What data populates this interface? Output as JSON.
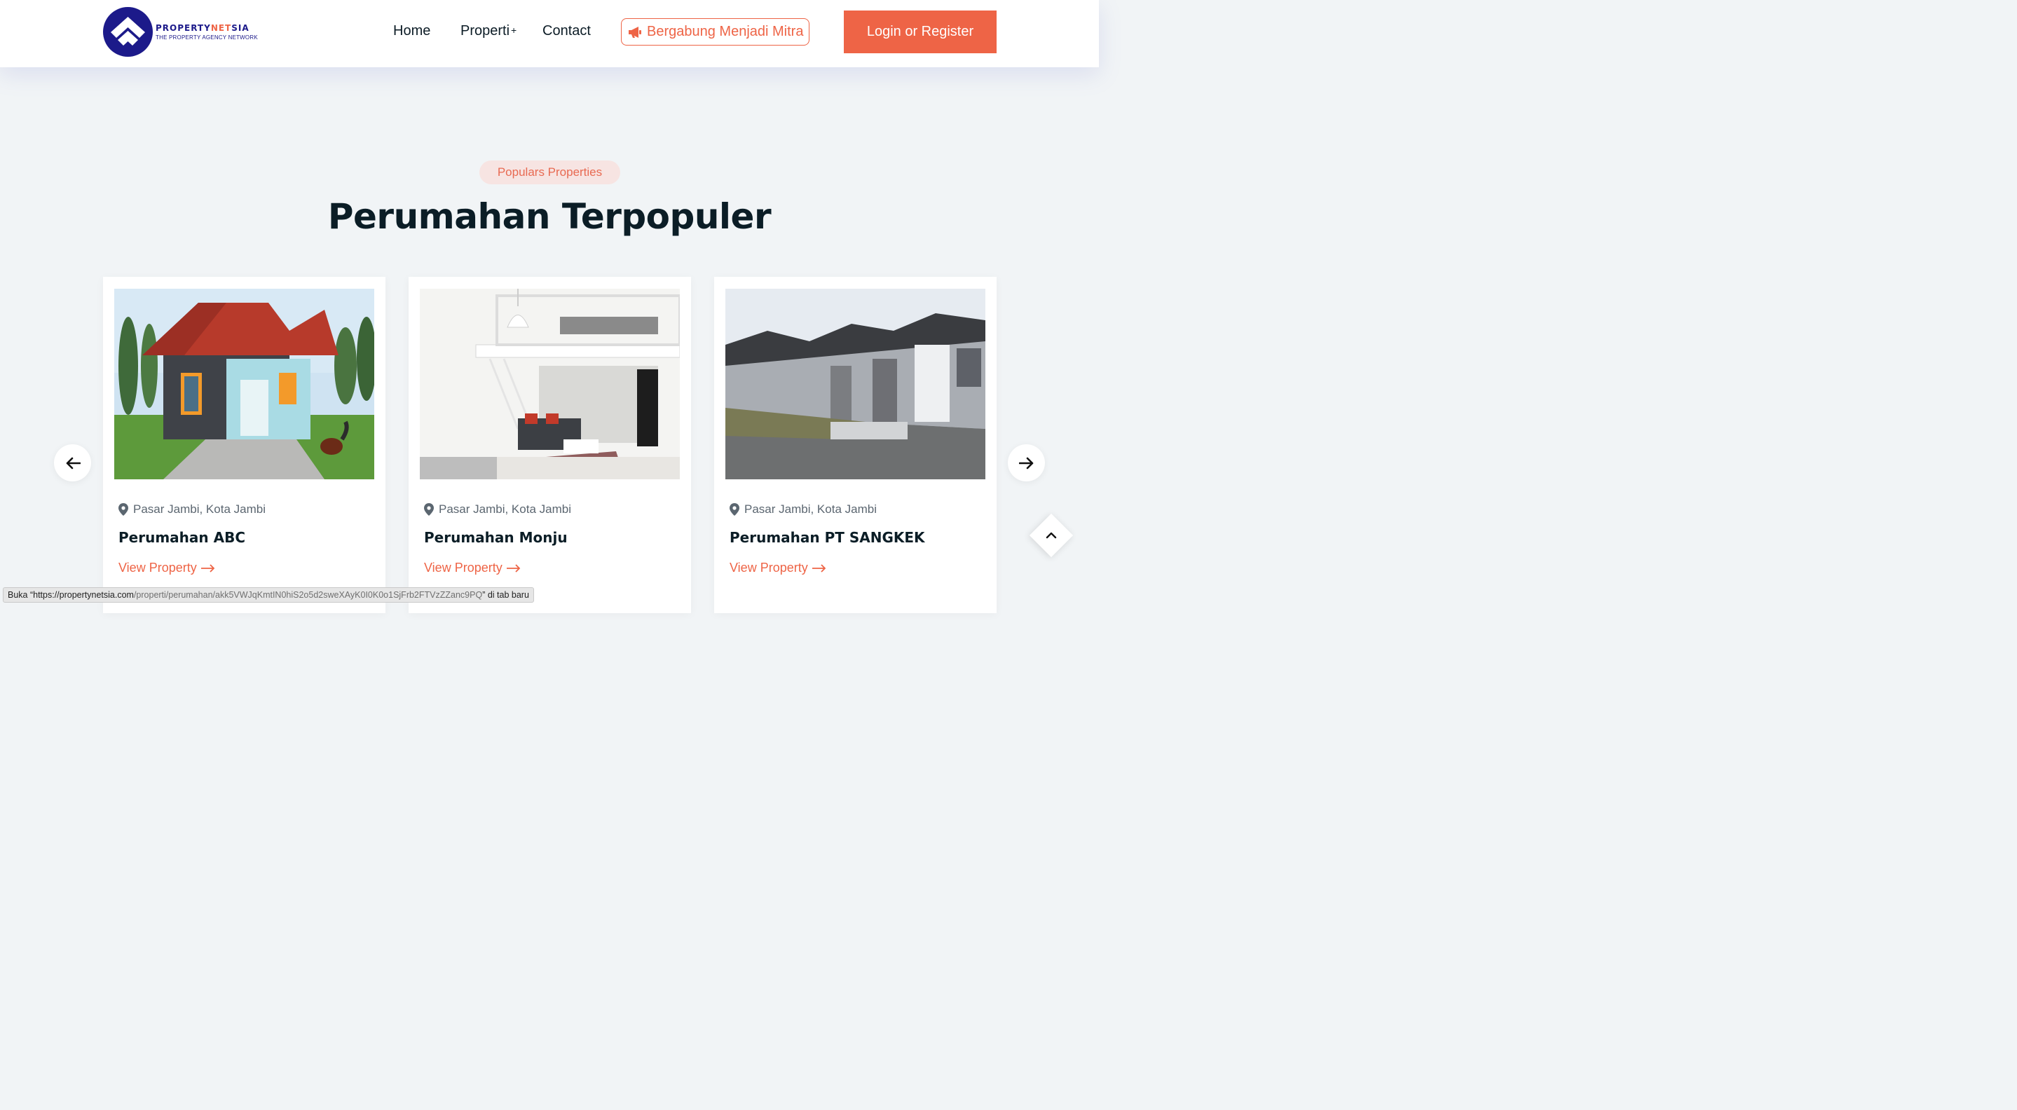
{
  "header": {
    "logo": {
      "name_part1": "PROPERTY",
      "name_part2": "NET",
      "name_part3": "SIA",
      "tagline": "THE PROPERTY AGENCY NETWORK"
    },
    "nav": {
      "home": "Home",
      "properti": "Properti",
      "properti_plus": "+",
      "contact": "Contact"
    },
    "mitra_button": "Bergabung Menjadi Mitra",
    "login_button": "Login or Register"
  },
  "section": {
    "badge": "Populars Properties",
    "title": "Perumahan Terpopuler"
  },
  "cards": [
    {
      "location": "Pasar Jambi, Kota Jambi",
      "title": "Perumahan ABC",
      "link": "View Property",
      "image": "house-red-roof-photo"
    },
    {
      "location": "Pasar Jambi, Kota Jambi",
      "title": "Perumahan Monju",
      "link": "View Property",
      "image": "loft-interior-photo"
    },
    {
      "location": "Pasar Jambi, Kota Jambi",
      "title": "Perumahan PT SANGKEK",
      "link": "View Property",
      "image": "row-houses-photo"
    }
  ],
  "status_bar": {
    "prefix": "Buka “https://propertynetsia.com",
    "path": "/properti/perumahan/akk5VWJqKmtIN0hiS2o5d2sweXAyK0I0K0o1SjFrb2FTVzZZanc9PQ",
    "suffix": "” di tab baru"
  },
  "colors": {
    "accent": "#ee6446",
    "brand_navy": "#1c1a8a",
    "background": "#f1f4f6",
    "heading": "#0b1d26"
  },
  "icons": {
    "prev": "arrow-left-icon",
    "next": "arrow-right-icon",
    "scroll_top": "chevron-up-icon",
    "location": "map-pin-icon",
    "megaphone": "megaphone-icon"
  }
}
